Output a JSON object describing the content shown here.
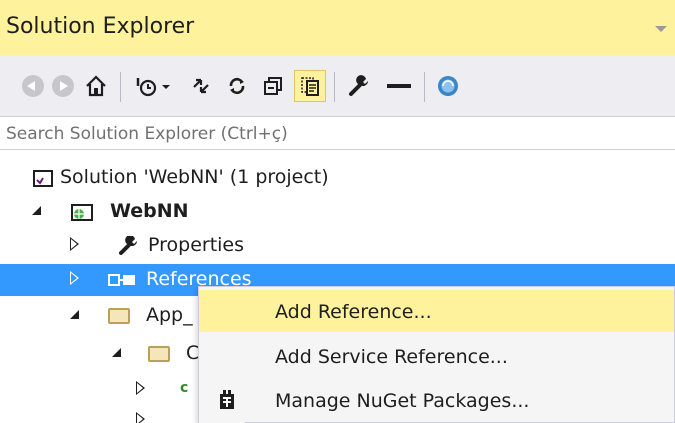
{
  "panel": {
    "title": "Solution Explorer"
  },
  "toolbar": {
    "icons": [
      "back-icon",
      "forward-icon",
      "home-icon",
      "pending-changes-icon",
      "sync-icon",
      "refresh-icon",
      "collapse-all-icon",
      "show-all-files-icon",
      "properties-icon",
      "preview-icon",
      "view-in-browser-icon"
    ]
  },
  "search": {
    "placeholder": "Search Solution Explorer (Ctrl+ç)"
  },
  "tree": {
    "solution": "Solution 'WebNN' (1 project)",
    "project": "WebNN",
    "properties": "Properties",
    "references": "References",
    "app_folder": "App_",
    "sub_folder": "C",
    "file1_prefix": "c",
    "file2_prefix": ""
  },
  "context_menu": {
    "items": [
      {
        "label": "Add Reference..."
      },
      {
        "label": "Add Service Reference..."
      },
      {
        "label": "Manage NuGet Packages..."
      }
    ]
  },
  "colors": {
    "highlight_yellow": "#fff29d",
    "selection_blue": "#3399ff",
    "toolbar_bg": "#eeeef2"
  }
}
